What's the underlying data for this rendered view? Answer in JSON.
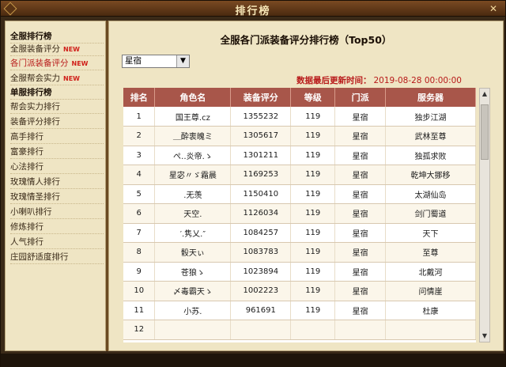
{
  "window": {
    "title": "排行榜",
    "close_icon": "close-icon"
  },
  "sidebar": {
    "items": [
      {
        "label": "全服排行榜",
        "type": "header",
        "new": ""
      },
      {
        "label": "全服装备评分",
        "type": "item",
        "new": "NEW"
      },
      {
        "label": "各门派装备评分",
        "type": "active",
        "new": "NEW"
      },
      {
        "label": "全服帮会实力",
        "type": "item",
        "new": "NEW"
      },
      {
        "label": "单服排行榜",
        "type": "header",
        "new": ""
      },
      {
        "label": "帮会实力排行",
        "type": "item",
        "new": ""
      },
      {
        "label": "装备评分排行",
        "type": "item",
        "new": ""
      },
      {
        "label": "高手排行",
        "type": "item",
        "new": ""
      },
      {
        "label": "富豪排行",
        "type": "item",
        "new": ""
      },
      {
        "label": "心法排行",
        "type": "item",
        "new": ""
      },
      {
        "label": "玫瑰情人排行",
        "type": "item",
        "new": ""
      },
      {
        "label": "玫瑰情圣排行",
        "type": "item",
        "new": ""
      },
      {
        "label": "小喇叭排行",
        "type": "item",
        "new": ""
      },
      {
        "label": "修炼排行",
        "type": "item",
        "new": ""
      },
      {
        "label": "人气排行",
        "type": "item",
        "new": ""
      },
      {
        "label": "庄园舒适度排行",
        "type": "item",
        "new": ""
      }
    ]
  },
  "main": {
    "title": "全服各门派装备评分排行榜（Top50）",
    "select": {
      "value": "星宿"
    },
    "update": {
      "label": "数据最后更新时间：",
      "value": "2019-08-28 00:00:00"
    },
    "table": {
      "headers": [
        "排名",
        "角色名",
        "装备评分",
        "等级",
        "门派",
        "服务器"
      ],
      "rows": [
        [
          "1",
          "国王尊.cz",
          "1355232",
          "119",
          "星宿",
          "独步江湖"
        ],
        [
          "2",
          "＿酔衷魄ミ",
          "1305617",
          "119",
          "星宿",
          "武林至尊"
        ],
        [
          "3",
          "ぺ‥炎帝.ゝ",
          "1301211",
          "119",
          "星宿",
          "独孤求败"
        ],
        [
          "4",
          "星宓〃ゞ霜晨",
          "1169253",
          "119",
          "星宿",
          "乾坤大挪移"
        ],
        [
          "5",
          ".无羡",
          "1150410",
          "119",
          "星宿",
          "太湖仙岛"
        ],
        [
          "6",
          "天空.",
          "1126034",
          "119",
          "星宿",
          "剑门蜀道"
        ],
        [
          "7",
          "′.隽乂.″",
          "1084257",
          "119",
          "星宿",
          "天下"
        ],
        [
          "8",
          "骰天ぃ",
          "1083783",
          "119",
          "星宿",
          "至尊"
        ],
        [
          "9",
          "苍狼ゝ",
          "1023894",
          "119",
          "星宿",
          "北戴河"
        ],
        [
          "10",
          "〆毒霸天ゝ",
          "1002223",
          "119",
          "星宿",
          "问情崖"
        ],
        [
          "11",
          "小苏.",
          "961691",
          "119",
          "星宿",
          "杜康"
        ],
        [
          "12",
          "",
          "",
          "",
          "",
          ""
        ]
      ]
    }
  }
}
